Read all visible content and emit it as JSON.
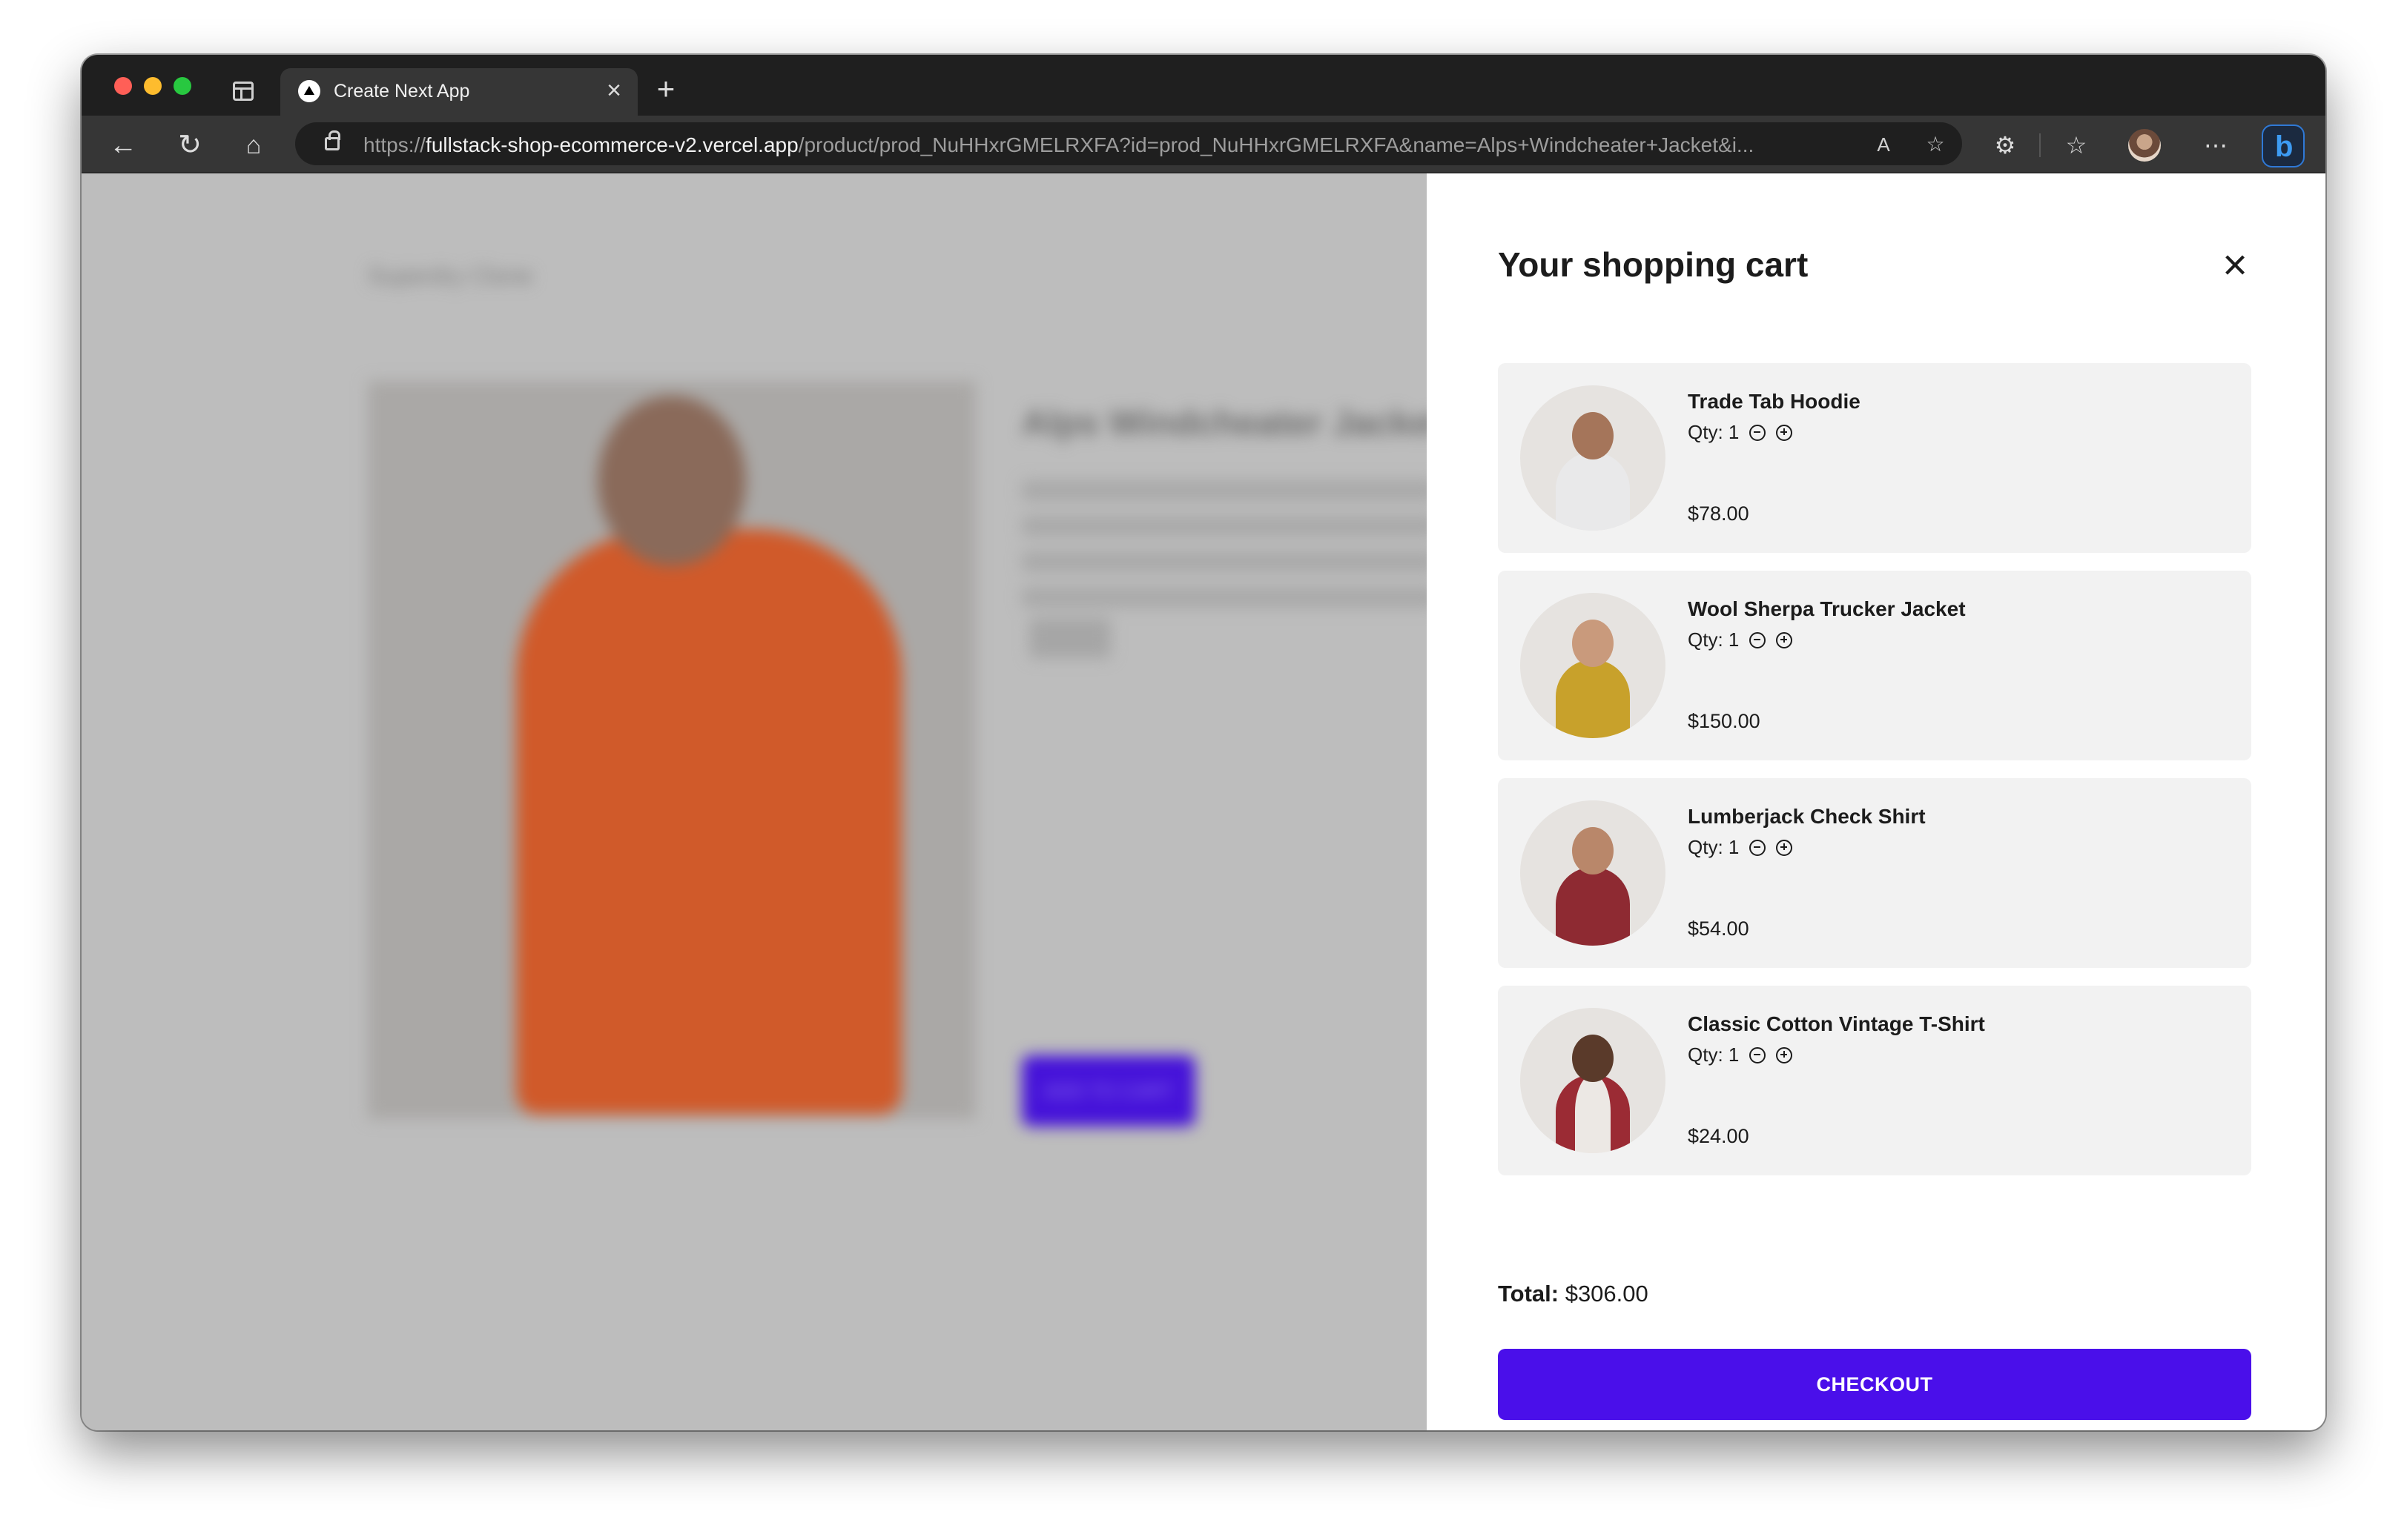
{
  "browser": {
    "tab_title": "Create Next App",
    "url_prefix": "https://",
    "url_host": "fullstack-shop-ecommerce-v2.vercel.app",
    "url_path": "/product/prod_NuHHxrGMELRXFA?id=prod_NuHHxrGMELRXFA&name=Alps+Windcheater+Jacket&i..."
  },
  "product_page": {
    "brand": "Superdry Clone",
    "product_name": "Alps Windcheater Jacket",
    "add_to_cart_label": "ADD TO CART"
  },
  "cart": {
    "title": "Your shopping cart",
    "qty_label": "Qty: 1",
    "items": [
      {
        "name": "Trade Tab Hoodie",
        "qty": "Qty: 1",
        "price": "$78.00"
      },
      {
        "name": "Wool Sherpa Trucker Jacket",
        "qty": "Qty: 1",
        "price": "$150.00"
      },
      {
        "name": "Lumberjack Check Shirt",
        "qty": "Qty: 1",
        "price": "$54.00"
      },
      {
        "name": "Classic Cotton Vintage T-Shirt",
        "qty": "Qty: 1",
        "price": "$24.00"
      }
    ],
    "total_label": "Total:",
    "total_value": "$306.00",
    "checkout_label": "CHECKOUT"
  },
  "colors": {
    "accent": "#4a0fea",
    "overlay": "#bdbdbd",
    "item_bg": "#f2f2f2"
  },
  "icons": [
    "tab-sidebar-icon",
    "nextjs-favicon-icon",
    "close-tab-icon",
    "new-tab-icon",
    "back-icon",
    "reload-icon",
    "home-icon",
    "lock-icon",
    "read-aloud-icon",
    "add-favorite-icon",
    "extensions-icon",
    "favorites-icon",
    "more-icon",
    "bing-icon",
    "close-icon",
    "minus-circle-icon",
    "plus-circle-icon"
  ]
}
